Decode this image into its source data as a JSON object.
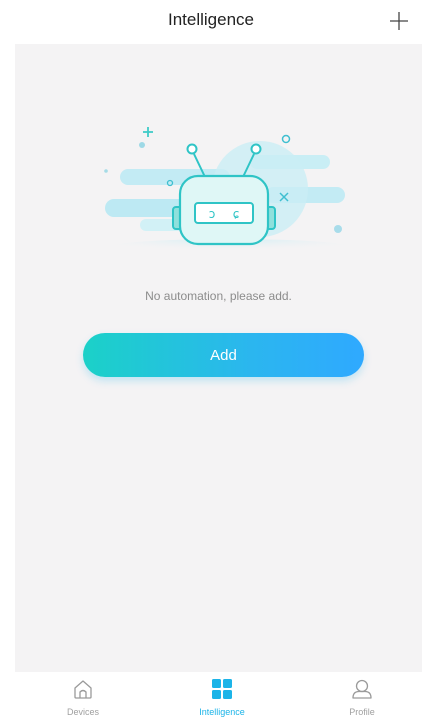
{
  "header": {
    "title": "Intelligence",
    "add_icon": "plus-icon"
  },
  "empty_state": {
    "illustration": "robot-illustration",
    "message": "No automation, please add.",
    "button_label": "Add"
  },
  "tabbar": {
    "items": [
      {
        "label": "Devices",
        "icon": "home-icon",
        "active": false
      },
      {
        "label": "Intelligence",
        "icon": "grid-icon",
        "active": true
      },
      {
        "label": "Profile",
        "icon": "person-icon",
        "active": false
      }
    ]
  },
  "colors": {
    "accent": "#1cb4e8",
    "button_gradient_start": "#1bd1c8",
    "button_gradient_end": "#2fa9ff",
    "background": "#f4f3f4"
  }
}
